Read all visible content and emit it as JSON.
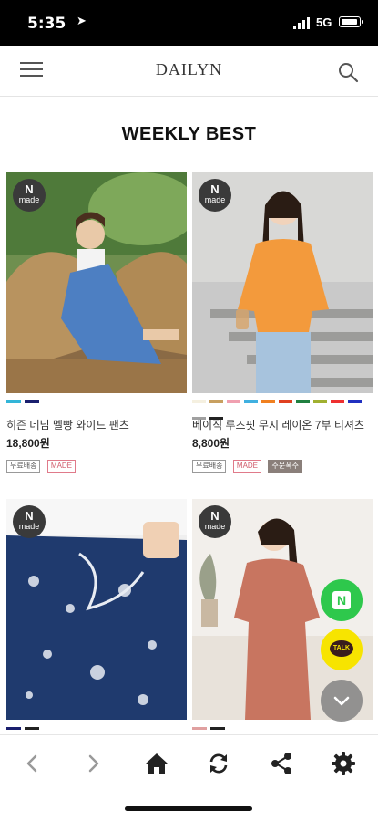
{
  "status_bar": {
    "time": "5:35",
    "network": "5G"
  },
  "header": {
    "logo": "DAILYN"
  },
  "section": {
    "title": "WEEKLY BEST"
  },
  "products": [
    {
      "badge_top": "N",
      "badge_bottom": "made",
      "photo": "woman-in-denim-overalls-on-wicker-chair",
      "swatches": [
        "#33b5d8",
        "#1a1f6e"
      ],
      "name": "히즌 데님 멜빵 와이드 팬츠",
      "price": "18,800원",
      "tags": [
        "무료배송",
        "MADE"
      ]
    },
    {
      "badge_top": "N",
      "badge_bottom": "made",
      "photo": "woman-in-orange-tshirt-on-stairs",
      "swatches": [
        "#f5f0e0",
        "#c8a060",
        "#f0a0b0",
        "#40b0e0",
        "#f08020",
        "#e04020",
        "#208040",
        "#a0b030",
        "#ee3030",
        "#20a060",
        "#c02040",
        "#2030c0",
        "#a0a0a0",
        "#222222"
      ],
      "name": "베이직 루즈핏 무지 레이온 7부 티셔츠",
      "price": "8,800원",
      "tags": [
        "무료배송",
        "MADE",
        "주문폭주"
      ]
    },
    {
      "badge_top": "N",
      "badge_bottom": "made",
      "photo": "navy-paisley-wrap-skirt",
      "swatches": [
        "#1a1f6e",
        "#222222"
      ]
    },
    {
      "badge_top": "N",
      "badge_bottom": "made",
      "photo": "woman-in-terracotta-dress",
      "swatches": [
        "#e0a0a0",
        "#222222"
      ]
    }
  ],
  "floating": {
    "naver_label": "N",
    "talk_label": "TALK"
  },
  "colors": {
    "naver": "#2ec84c",
    "kakao": "#f7e400",
    "text": "#111111"
  }
}
